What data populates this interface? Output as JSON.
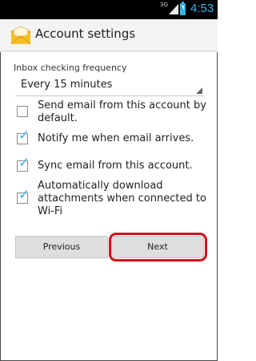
{
  "status_bar": {
    "network": "3G",
    "time": "4:53"
  },
  "action_bar": {
    "title": "Account settings"
  },
  "settings": {
    "frequency_label": "Inbox checking frequency",
    "frequency_value": "Every 15 minutes",
    "options": [
      {
        "label_line1": "Send email from this account by",
        "label_line2": "default.",
        "checked": false
      },
      {
        "label_line1": "Notify me when email arrives.",
        "checked": true
      },
      {
        "label_line1": "Sync email from this account.",
        "checked": true
      },
      {
        "label_line1": "Automatically download",
        "label_line2": "attachments when connected to",
        "label_line3": "Wi-Fi",
        "checked": true
      }
    ]
  },
  "buttons": {
    "previous": "Previous",
    "next": "Next"
  },
  "colors": {
    "accent": "#33b5e5",
    "highlight": "#d0121b",
    "button": "#dedede"
  }
}
